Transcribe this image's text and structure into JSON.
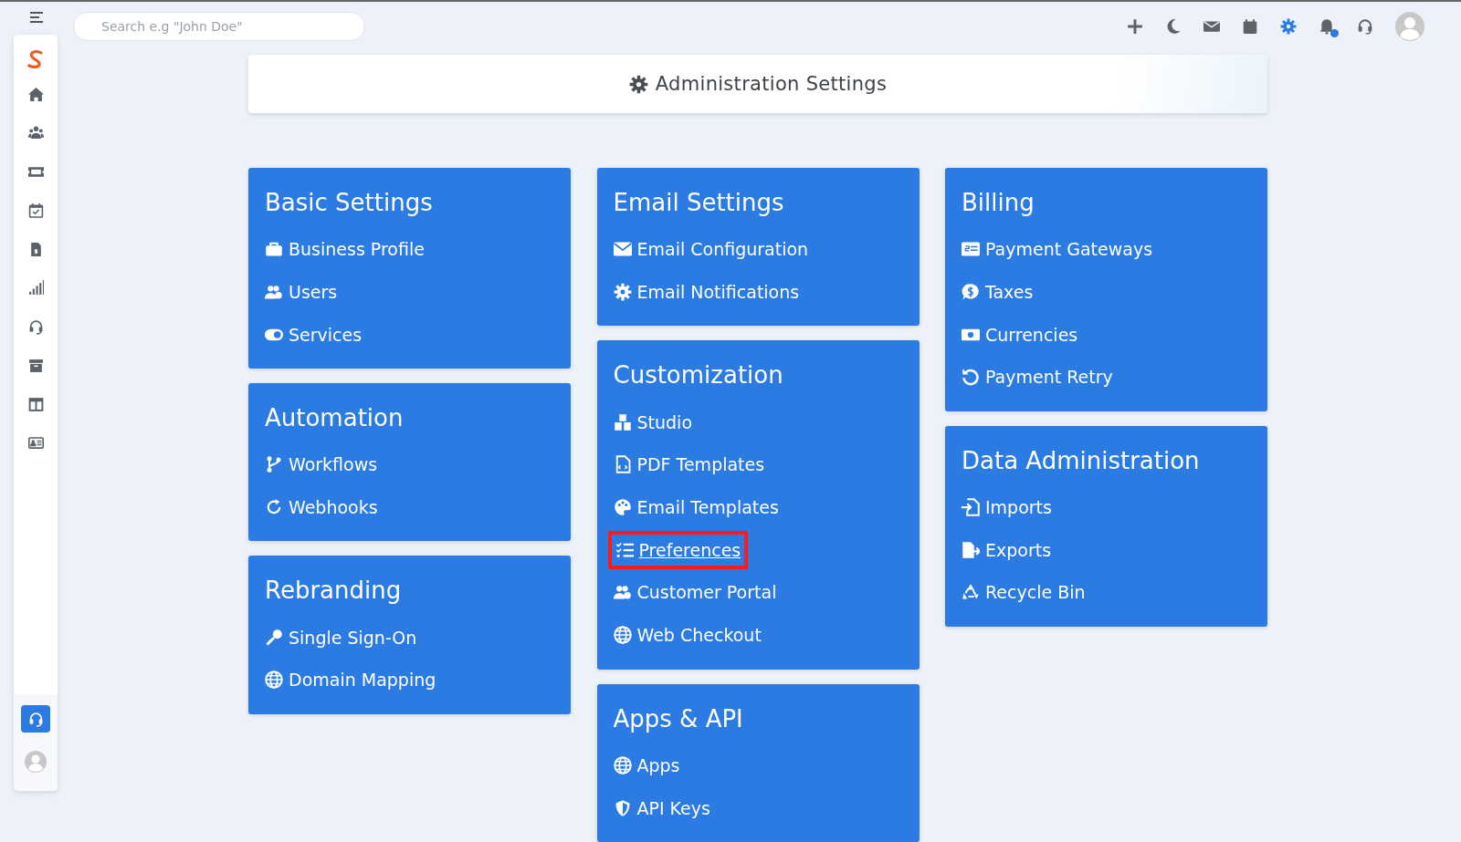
{
  "topbar": {
    "search": {
      "placeholder": "Search e.g \"John Doe\""
    },
    "icons": [
      {
        "selected": false
      },
      {
        "selected": false
      },
      {
        "selected": false
      },
      {
        "selected": false
      },
      {
        "selected": true
      },
      {
        "selected": false
      },
      {
        "selected": false
      }
    ],
    "notification_dot": true
  },
  "sidebar": {
    "items": [
      {
        "selected": false
      },
      {
        "selected": false
      },
      {
        "selected": false
      },
      {
        "selected": false
      },
      {
        "selected": false
      },
      {
        "selected": false
      },
      {
        "selected": false
      },
      {
        "selected": false
      },
      {
        "selected": false
      },
      {
        "selected": false
      }
    ],
    "support": {
      "selected": true
    }
  },
  "page_title": "Administration Settings",
  "columns": [
    [
      {
        "title": "Basic Settings",
        "links": [
          {
            "label": "Business Profile",
            "highlighted": false
          },
          {
            "label": "Users",
            "highlighted": false
          },
          {
            "label": "Services",
            "highlighted": false
          }
        ]
      },
      {
        "title": "Automation",
        "links": [
          {
            "label": "Workflows",
            "highlighted": false
          },
          {
            "label": "Webhooks",
            "highlighted": false
          }
        ]
      },
      {
        "title": "Rebranding",
        "links": [
          {
            "label": "Single Sign-On",
            "highlighted": false
          },
          {
            "label": "Domain Mapping",
            "highlighted": false
          }
        ]
      }
    ],
    [
      {
        "title": "Email Settings",
        "links": [
          {
            "label": "Email Configuration",
            "highlighted": false
          },
          {
            "label": "Email Notifications",
            "highlighted": false
          }
        ]
      },
      {
        "title": "Customization",
        "links": [
          {
            "label": "Studio",
            "highlighted": false
          },
          {
            "label": "PDF Templates",
            "highlighted": false
          },
          {
            "label": "Email Templates",
            "highlighted": false
          },
          {
            "label": "Preferences",
            "highlighted": true
          },
          {
            "label": "Customer Portal",
            "highlighted": false
          },
          {
            "label": "Web Checkout",
            "highlighted": false
          }
        ]
      },
      {
        "title": "Apps & API",
        "links": [
          {
            "label": "Apps",
            "highlighted": false
          },
          {
            "label": "API Keys",
            "highlighted": false
          }
        ]
      }
    ],
    [
      {
        "title": "Billing",
        "links": [
          {
            "label": "Payment Gateways",
            "highlighted": false
          },
          {
            "label": "Taxes",
            "highlighted": false
          },
          {
            "label": "Currencies",
            "highlighted": false
          },
          {
            "label": "Payment Retry",
            "highlighted": false
          }
        ]
      },
      {
        "title": "Data Administration",
        "links": [
          {
            "label": "Imports",
            "highlighted": false
          },
          {
            "label": "Exports",
            "highlighted": false
          },
          {
            "label": "Recycle Bin",
            "highlighted": false
          }
        ]
      }
    ]
  ]
}
